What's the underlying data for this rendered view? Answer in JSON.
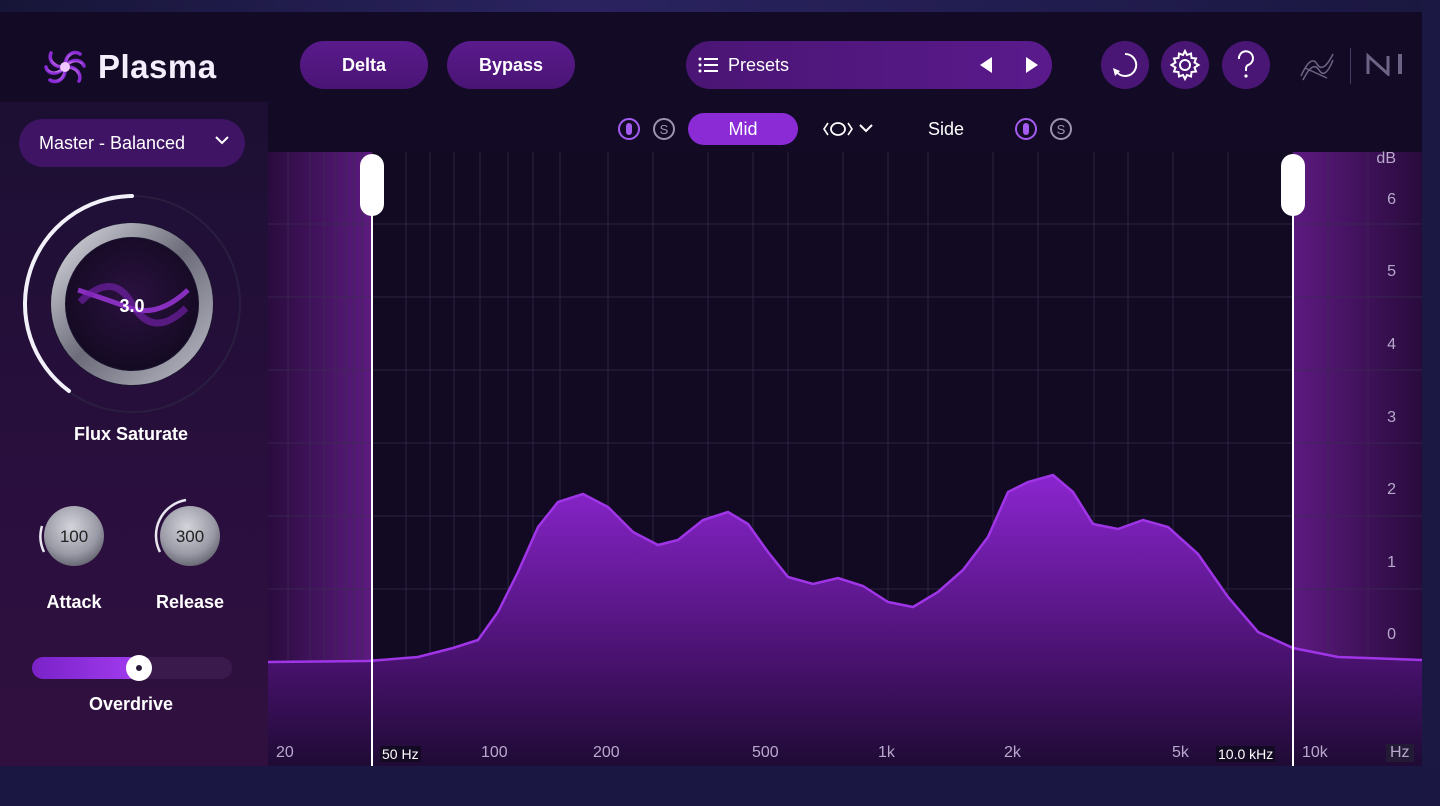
{
  "app": {
    "name": "Plasma"
  },
  "header": {
    "delta_label": "Delta",
    "bypass_label": "Bypass",
    "presets_label": "Presets"
  },
  "preset_selector": {
    "value": "Master - Balanced"
  },
  "controls": {
    "flux_saturate": {
      "label": "Flux Saturate",
      "value": "3.0"
    },
    "attack": {
      "label": "Attack",
      "value": "100"
    },
    "release": {
      "label": "Release",
      "value": "300"
    },
    "overdrive": {
      "label": "Overdrive",
      "level": 0.48
    }
  },
  "mid_side": {
    "mid_label": "Mid",
    "side_label": "Side",
    "solo_glyph": "S"
  },
  "graph": {
    "low_cutoff_label": "50 Hz",
    "high_cutoff_label": "10.0 kHz",
    "freq_labels": [
      "20",
      "100",
      "200",
      "500",
      "1k",
      "2k",
      "5k",
      "10k"
    ],
    "freq_unit": "Hz",
    "db_unit": "dB",
    "db_labels": [
      "6",
      "5",
      "4",
      "3",
      "2",
      "1",
      "0"
    ]
  },
  "colors": {
    "accent": "#8a2bd6",
    "panel": "#130b26",
    "button": "#4a1675"
  },
  "icons": {
    "logo": "plasma-logo-icon",
    "presets": "list-icon",
    "prev": "triangle-left-icon",
    "next": "triangle-right-icon",
    "undo": "loop-icon",
    "settings": "gear-icon",
    "help": "question-icon",
    "brand_izotope": "izotope-logo",
    "brand_ni": "native-instruments-logo",
    "link": "stereo-link-icon",
    "dropdown": "chevron-down-icon"
  }
}
